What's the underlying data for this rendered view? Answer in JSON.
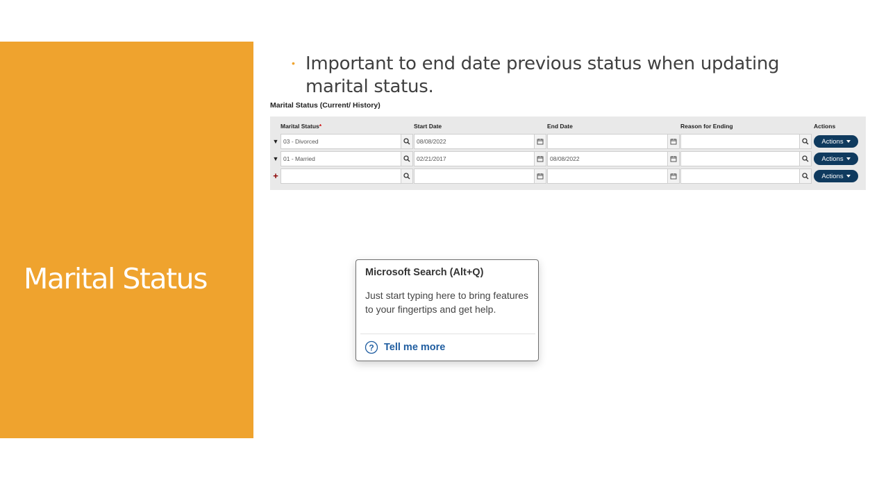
{
  "slide": {
    "title": "Marital Status",
    "bullet_marker": "•",
    "bullet_line1": "Important to end date previous status when updating",
    "bullet_line2": "marital status.",
    "accent_color": "#EFA32E"
  },
  "table": {
    "title": "Marital Status (Current/ History)",
    "headers": {
      "marital_status": "Marital Status",
      "required_mark": "*",
      "start_date": "Start Date",
      "end_date": "End Date",
      "reason": "Reason for Ending",
      "actions": "Actions"
    },
    "rows": [
      {
        "control": "▼",
        "marital_status": "03 - Divorced",
        "start_date": "08/08/2022",
        "end_date": "",
        "reason": "",
        "actions": "Actions"
      },
      {
        "control": "▼",
        "marital_status": "01 - Married",
        "start_date": "02/21/2017",
        "end_date": "08/08/2022",
        "reason": "",
        "actions": "Actions"
      },
      {
        "control": "+",
        "marital_status": "",
        "start_date": "",
        "end_date": "",
        "reason": "",
        "actions": "Actions"
      }
    ],
    "actions_color": "#0F3A5E"
  },
  "tooltip": {
    "title": "Microsoft Search (Alt+Q)",
    "body": "Just start typing here to bring features to your fingertips and get help.",
    "link": "Tell me more",
    "link_icon": "question-circle-icon",
    "link_color": "#1F5DA0"
  }
}
